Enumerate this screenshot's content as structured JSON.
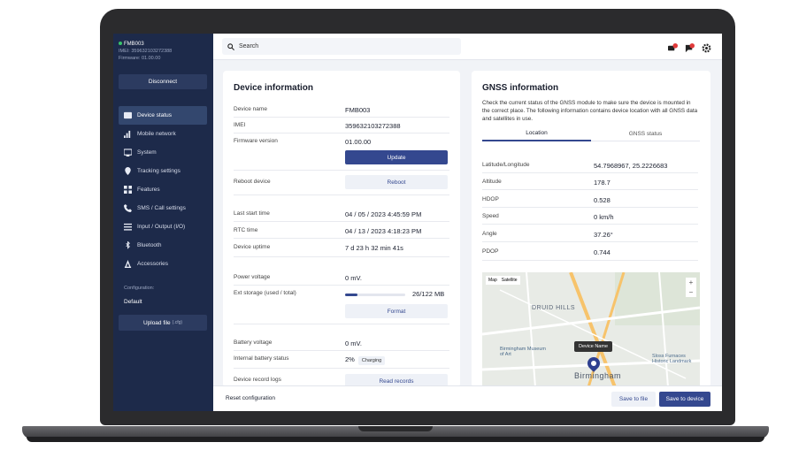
{
  "device_header": {
    "name": "FMB003",
    "imei_line": "IMEI: 359632103272388",
    "firmware_line": "Firmware: 01.00.00"
  },
  "sidebar": {
    "disconnect_label": "Disconnect",
    "items": [
      {
        "label": "Device status",
        "icon": "device-status-icon"
      },
      {
        "label": "Mobile network",
        "icon": "signal-bars-icon"
      },
      {
        "label": "System",
        "icon": "system-icon"
      },
      {
        "label": "Tracking settings",
        "icon": "location-pin-icon"
      },
      {
        "label": "Features",
        "icon": "grid-icon"
      },
      {
        "label": "SMS / Call settings",
        "icon": "phone-icon"
      },
      {
        "label": "Input / Output (I/O)",
        "icon": "io-icon"
      },
      {
        "label": "Bluetooth",
        "icon": "bluetooth-icon"
      },
      {
        "label": "Accessories",
        "icon": "accessories-icon"
      }
    ],
    "config_label": "Configuration:",
    "config_value": "Default",
    "upload_label": "Upload file",
    "upload_hint": "(.cfg)"
  },
  "topbar": {
    "search_placeholder": "Search"
  },
  "device_info": {
    "title": "Device information",
    "rows": {
      "device_name": {
        "label": "Device name",
        "value": "FMB003"
      },
      "imei": {
        "label": "IMEI",
        "value": "359632103272388"
      },
      "firmware": {
        "label": "Firmware version",
        "value": "01.00.00"
      },
      "update_label": "Update",
      "reboot": {
        "label": "Reboot device",
        "button": "Reboot"
      },
      "last_start": {
        "label": "Last start time",
        "value": "04 / 05 / 2023  4:45:59 PM"
      },
      "rtc": {
        "label": "RTC time",
        "value": "04 / 13 / 2023  4:18:23 PM"
      },
      "uptime": {
        "label": "Device uptime",
        "value": "7 d 23 h 32 min 41s"
      },
      "power": {
        "label": "Power voltage",
        "value": "0 mV."
      },
      "storage": {
        "label": "Ext storage (used / total)",
        "value": "26/122 MB",
        "fraction": 0.21
      },
      "format_label": "Format",
      "battery_voltage": {
        "label": "Battery voltage",
        "value": "0 mV."
      },
      "battery_status": {
        "label": "Internal battery status",
        "value": "2%",
        "badge": "Charging"
      },
      "record_logs": {
        "label": "Device record logs",
        "button": "Read records"
      }
    }
  },
  "gnss": {
    "title": "GNSS information",
    "description": "Check the current status of the GNSS module to make sure the device is mounted in the correct place. The following information contains device location with all GNSS data and satellites in use.",
    "tabs": [
      "Location",
      "GNSS status"
    ],
    "rows": [
      {
        "label": "Latitude/Longitude",
        "value": "54.7968967, 25.2226683"
      },
      {
        "label": "Altitude",
        "value": "178.7"
      },
      {
        "label": "HDOP",
        "value": "0.528"
      },
      {
        "label": "Speed",
        "value": "0 km/h"
      },
      {
        "label": "Angle",
        "value": "37.26°"
      },
      {
        "label": "PDOP",
        "value": "0.744"
      }
    ],
    "map": {
      "type_map": "Map",
      "type_sat": "Satellite",
      "label_druid": "DRUID HILLS",
      "label_museum": "Birmingham Museum of Art",
      "label_sloss": "Sloss Furnaces Historic Landmark",
      "label_city": "Birmingham",
      "tooltip": "Device Name",
      "zoom_in": "+",
      "zoom_out": "−"
    }
  },
  "footer": {
    "reset_label": "Reset configuration",
    "save_file_label": "Save to file",
    "save_device_label": "Save to device"
  },
  "colors": {
    "sidebar": "#1d2a4a",
    "accent": "#34488f",
    "online": "#39c46b",
    "alert": "#e03a3a"
  }
}
